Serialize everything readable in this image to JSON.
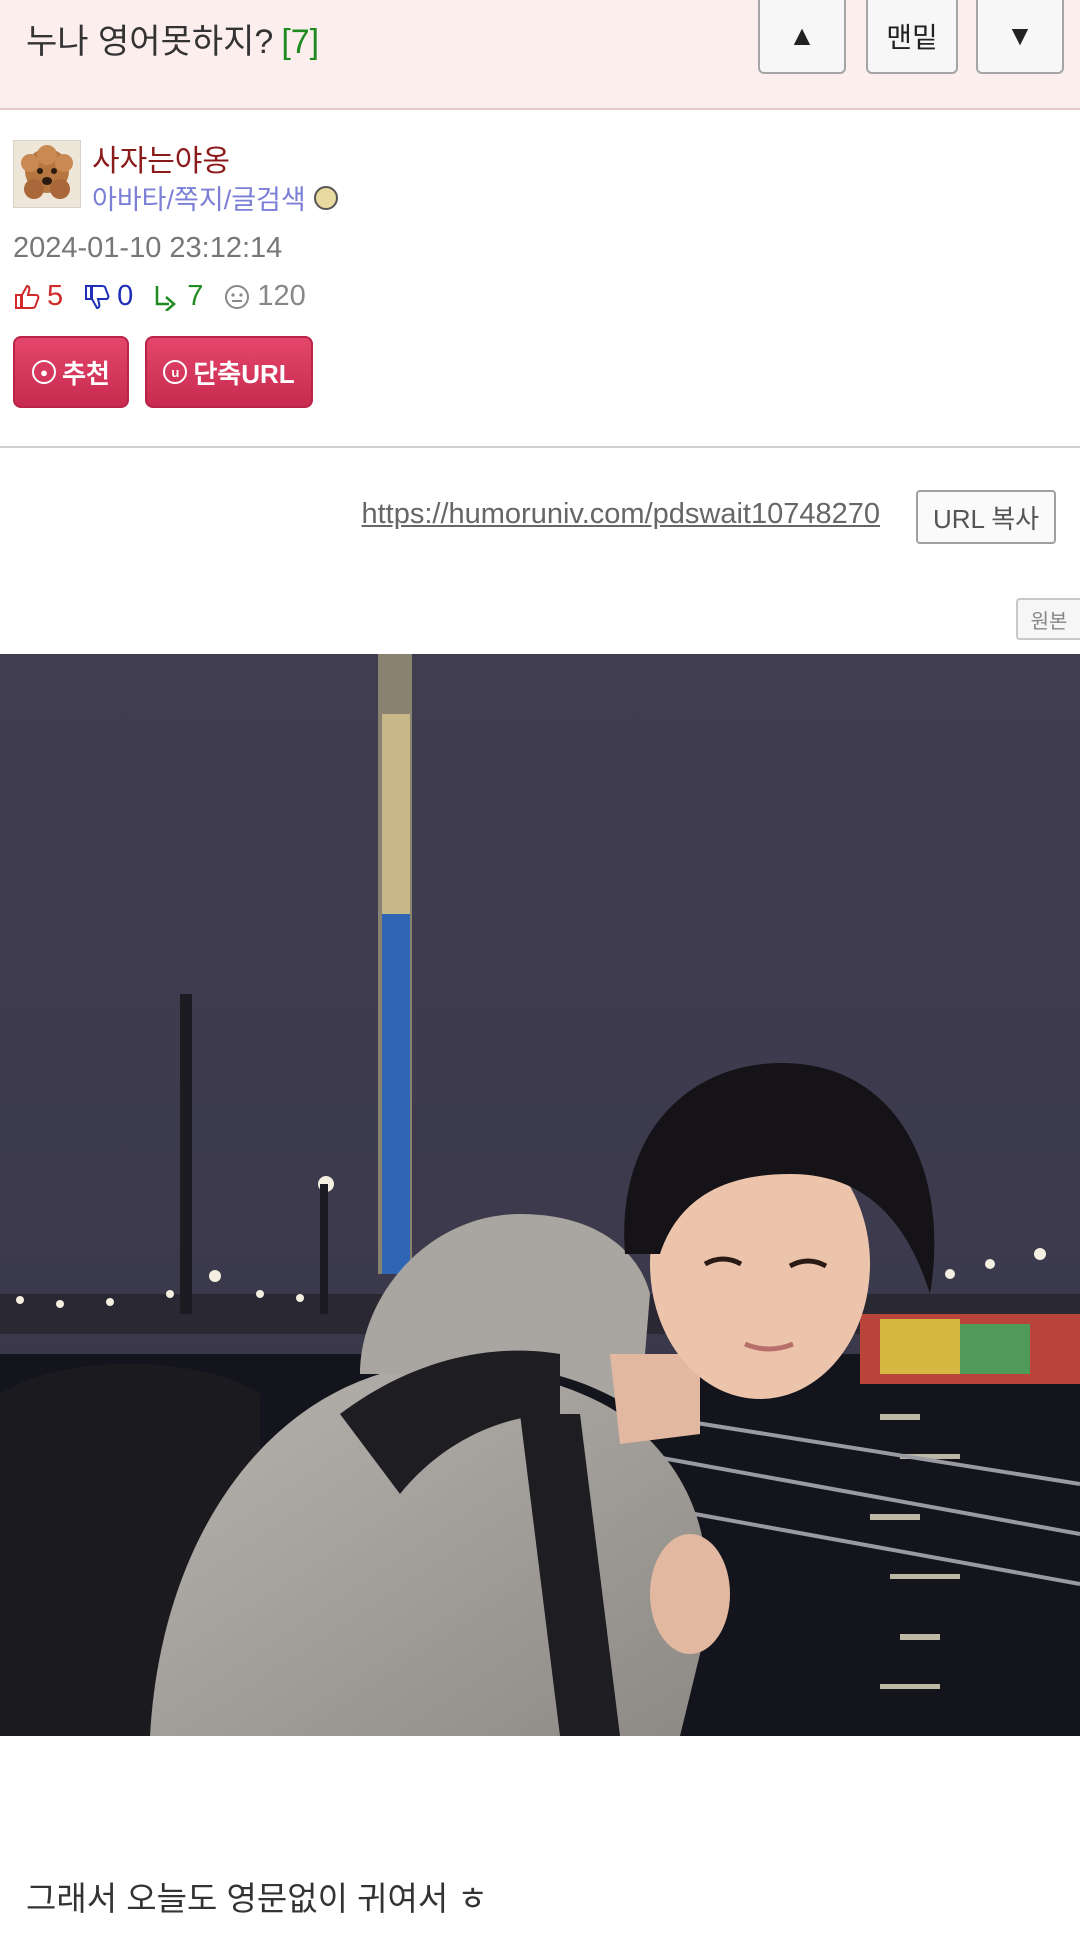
{
  "header": {
    "title": "누나 영어못하지?",
    "comment_count": "[7]",
    "nav_up_label": "▲",
    "nav_bottom_label": "맨밑",
    "nav_down_label": "▼"
  },
  "author": {
    "nickname": "사자는야옹",
    "links": "아바타/쪽지/글검색",
    "avatar_icon": "poodle-avatar",
    "level_icon": "level-badge-icon"
  },
  "post": {
    "date": "2024-01-10 23:12:14",
    "upvotes": "5",
    "downvotes": "0",
    "replies": "7",
    "views": "120",
    "recommend_label": "추천",
    "shorturl_label": "단축URL",
    "url": "https://humoruniv.com/pdswait10748270",
    "copy_label": "URL 복사",
    "original_label": "원본",
    "body": "그래서 오늘도 영문없이 귀여서 ㅎ"
  },
  "colors": {
    "header_bg": "#fdeeee",
    "accent_red": "#d12a50",
    "upvote": "#d12a2a",
    "downvote": "#1f2fb8",
    "reply": "#1f8a1f",
    "nickname": "#8b1a1a",
    "links": "#7b7fd6"
  },
  "image": {
    "description_icon": "photo-young-man-night-harbor"
  }
}
